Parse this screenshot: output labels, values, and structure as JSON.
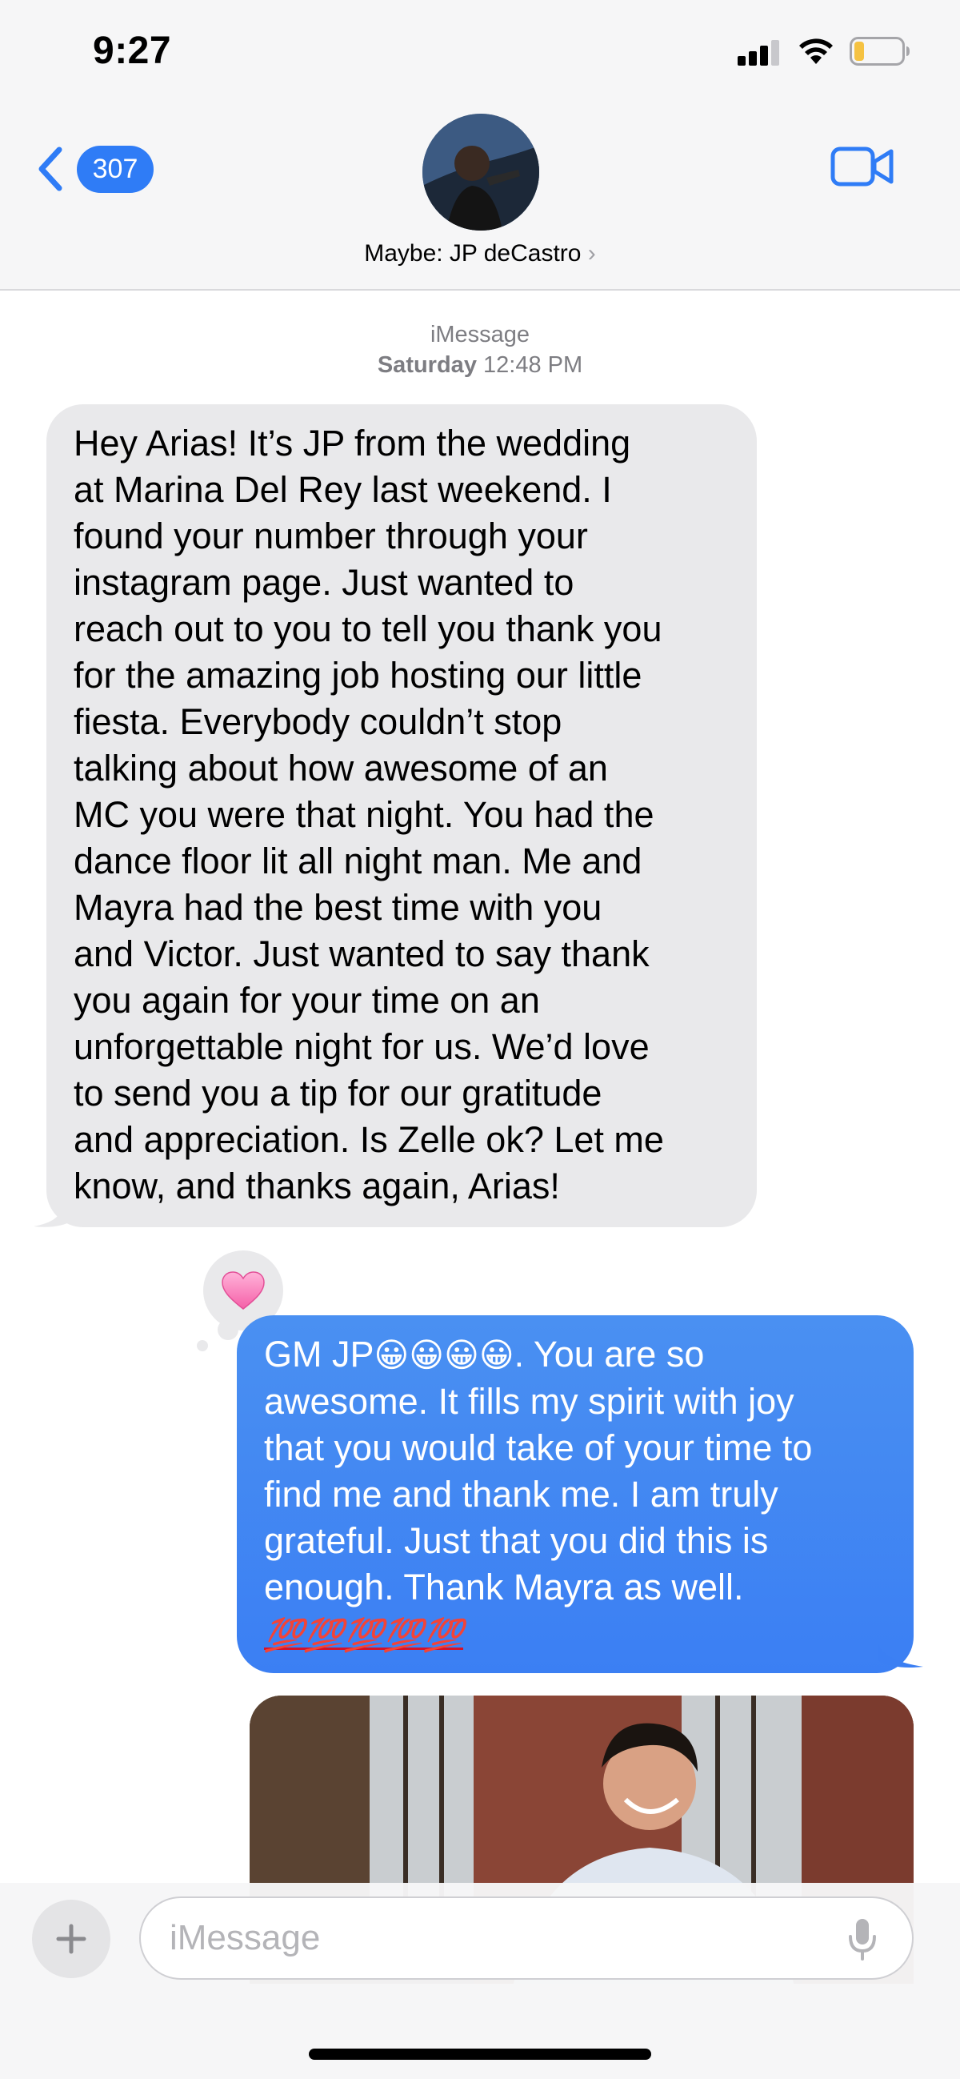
{
  "status_bar": {
    "time": "9:27"
  },
  "header": {
    "back_badge": "307",
    "contact_name": "Maybe: JP deCastro",
    "contact_chevron": "›"
  },
  "conversation": {
    "service": "iMessage",
    "timestamp_day": "Saturday",
    "timestamp_time": "12:48 PM",
    "incoming_message": "Hey Arias! It’s JP from the wedding\nat Marina Del Rey last weekend. I\nfound your number through your\ninstagram page. Just wanted to\nreach out to you to tell you thank you\nfor the amazing job hosting our little\nfiesta. Everybody couldn’t stop\ntalking about how awesome of an\nMC you were that night. You had the\ndance floor lit all night man. Me and\nMayra had the best time with you\nand Victor. Just wanted to say thank\nyou again for your time on an\nunforgettable night for us. We’d love\nto send you a tip for our gratitude\nand appreciation. Is Zelle ok? Let me\nknow, and thanks again, Arias!",
    "reaction": "heart",
    "outgoing_prefix": "GM JP",
    "outgoing_emojis": "😀😀😀😀",
    "outgoing_message": ". You are so\nawesome. It fills my spirit with joy\nthat you would take of your time to\nfind me and thank me. I am truly\ngrateful. Just that you did this is\nenough. Thank Mayra as well.",
    "outgoing_hundreds": "💯💯💯💯💯",
    "attachment": "image"
  },
  "composer": {
    "placeholder": "iMessage"
  },
  "colors": {
    "accent": "#2f7cf6",
    "outgoing_bubble": "#3b82f6",
    "incoming_bubble": "#e9e9eb",
    "reaction_heart": "#f772b5"
  },
  "icons": [
    "back-chevron-icon",
    "video-camera-icon",
    "plus-icon",
    "microphone-icon",
    "signal-icon",
    "wifi-icon",
    "battery-icon",
    "heart-reaction-icon"
  ]
}
